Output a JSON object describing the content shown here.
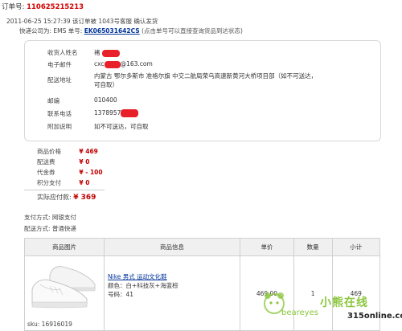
{
  "order": {
    "label": "订单号:",
    "number": "110625215213",
    "status": "2011-06-25 15:27:39 该订单被 1043号客服 确认发货",
    "express_prefix": "快递公司为:",
    "express_company": "EMS",
    "tracking_label": "单号:",
    "tracking_number": "EK065031642CS",
    "tracking_hint": "(点击单号可以直接查询货品到达状态)"
  },
  "address": {
    "name_label": "收货人姓名",
    "name_value": "褚",
    "email_label": "电子邮件",
    "email_prefix": "cxc",
    "email_suffix": "@163.com",
    "addr_label": "配送地址",
    "addr_value_1": "内蒙古 鄂尔多斯市 准格尔旗 中交二航局荣乌高速新黄河大桥项目部（如不可送达，",
    "addr_value_2": "可自取）",
    "zip_label": "邮编",
    "zip_value": "010400",
    "phone_label": "联系电话",
    "phone_value": "1378957",
    "note_label": "附加说明",
    "note_value": "如不可送达，可自取"
  },
  "price": {
    "goods_label": "商品价格",
    "goods_value": "¥ 469",
    "ship_label": "配送费",
    "ship_value": "¥ 0",
    "coupon_label": "代金券",
    "coupon_value": "¥ - 100",
    "points_label": "积分支付",
    "points_value": "¥ 0",
    "final_label": "实际应付款:",
    "final_value": "¥ 369"
  },
  "payment": {
    "pay_label": "支付方式:",
    "pay_value": "网银支付",
    "ship_label": "配送方式:",
    "ship_value": "普通快递"
  },
  "table": {
    "headers": [
      "商品图片",
      "商品信息",
      "单价",
      "数量",
      "小计"
    ],
    "product_name": "Nike 男式 运动文化鞋",
    "color_line": "颜色：白+科技灰+海蓝棕",
    "size_line": "号码：41",
    "sku": "sku: 16916019",
    "unit_price": "469.00",
    "quantity": "1",
    "subtotal": "469"
  },
  "watermark": {
    "cn": "小熊在线",
    "en": "beareyes",
    "site": "315online.com"
  },
  "colors": {
    "accent_red": "#d40000",
    "link_blue": "#003399",
    "redaction": "#e8202a",
    "watermark_green": "#8cc63e"
  }
}
